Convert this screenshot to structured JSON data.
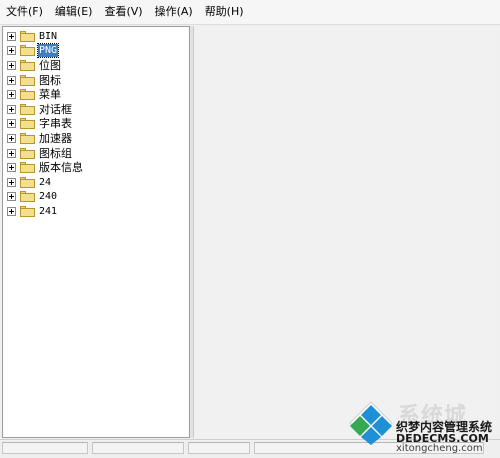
{
  "menubar": {
    "items": [
      "文件(F)",
      "编辑(E)",
      "查看(V)",
      "操作(A)",
      "帮助(H)"
    ]
  },
  "tree": {
    "items": [
      {
        "label": "BIN",
        "selected": false
      },
      {
        "label": "PNG",
        "selected": true
      },
      {
        "label": "位图",
        "selected": false
      },
      {
        "label": "图标",
        "selected": false
      },
      {
        "label": "菜单",
        "selected": false
      },
      {
        "label": "对话框",
        "selected": false
      },
      {
        "label": "字串表",
        "selected": false
      },
      {
        "label": "加速器",
        "selected": false
      },
      {
        "label": "图标组",
        "selected": false
      },
      {
        "label": "版本信息",
        "selected": false
      },
      {
        "label": "24",
        "selected": false
      },
      {
        "label": "240",
        "selected": false
      },
      {
        "label": "241",
        "selected": false
      }
    ]
  },
  "watermark": {
    "title": "系统城",
    "subtitle": "织梦内容管理系统",
    "domain": "DEDECMS.COM",
    "site": "xitongcheng.com"
  },
  "colors": {
    "selection": "#3d7fc1",
    "folder": "#f3e08d",
    "logo_blue": "#1f8fd6",
    "logo_green": "#35a853"
  },
  "icons": {
    "tree_expander": "plus-box-icon",
    "tree_folder": "folder-icon"
  }
}
